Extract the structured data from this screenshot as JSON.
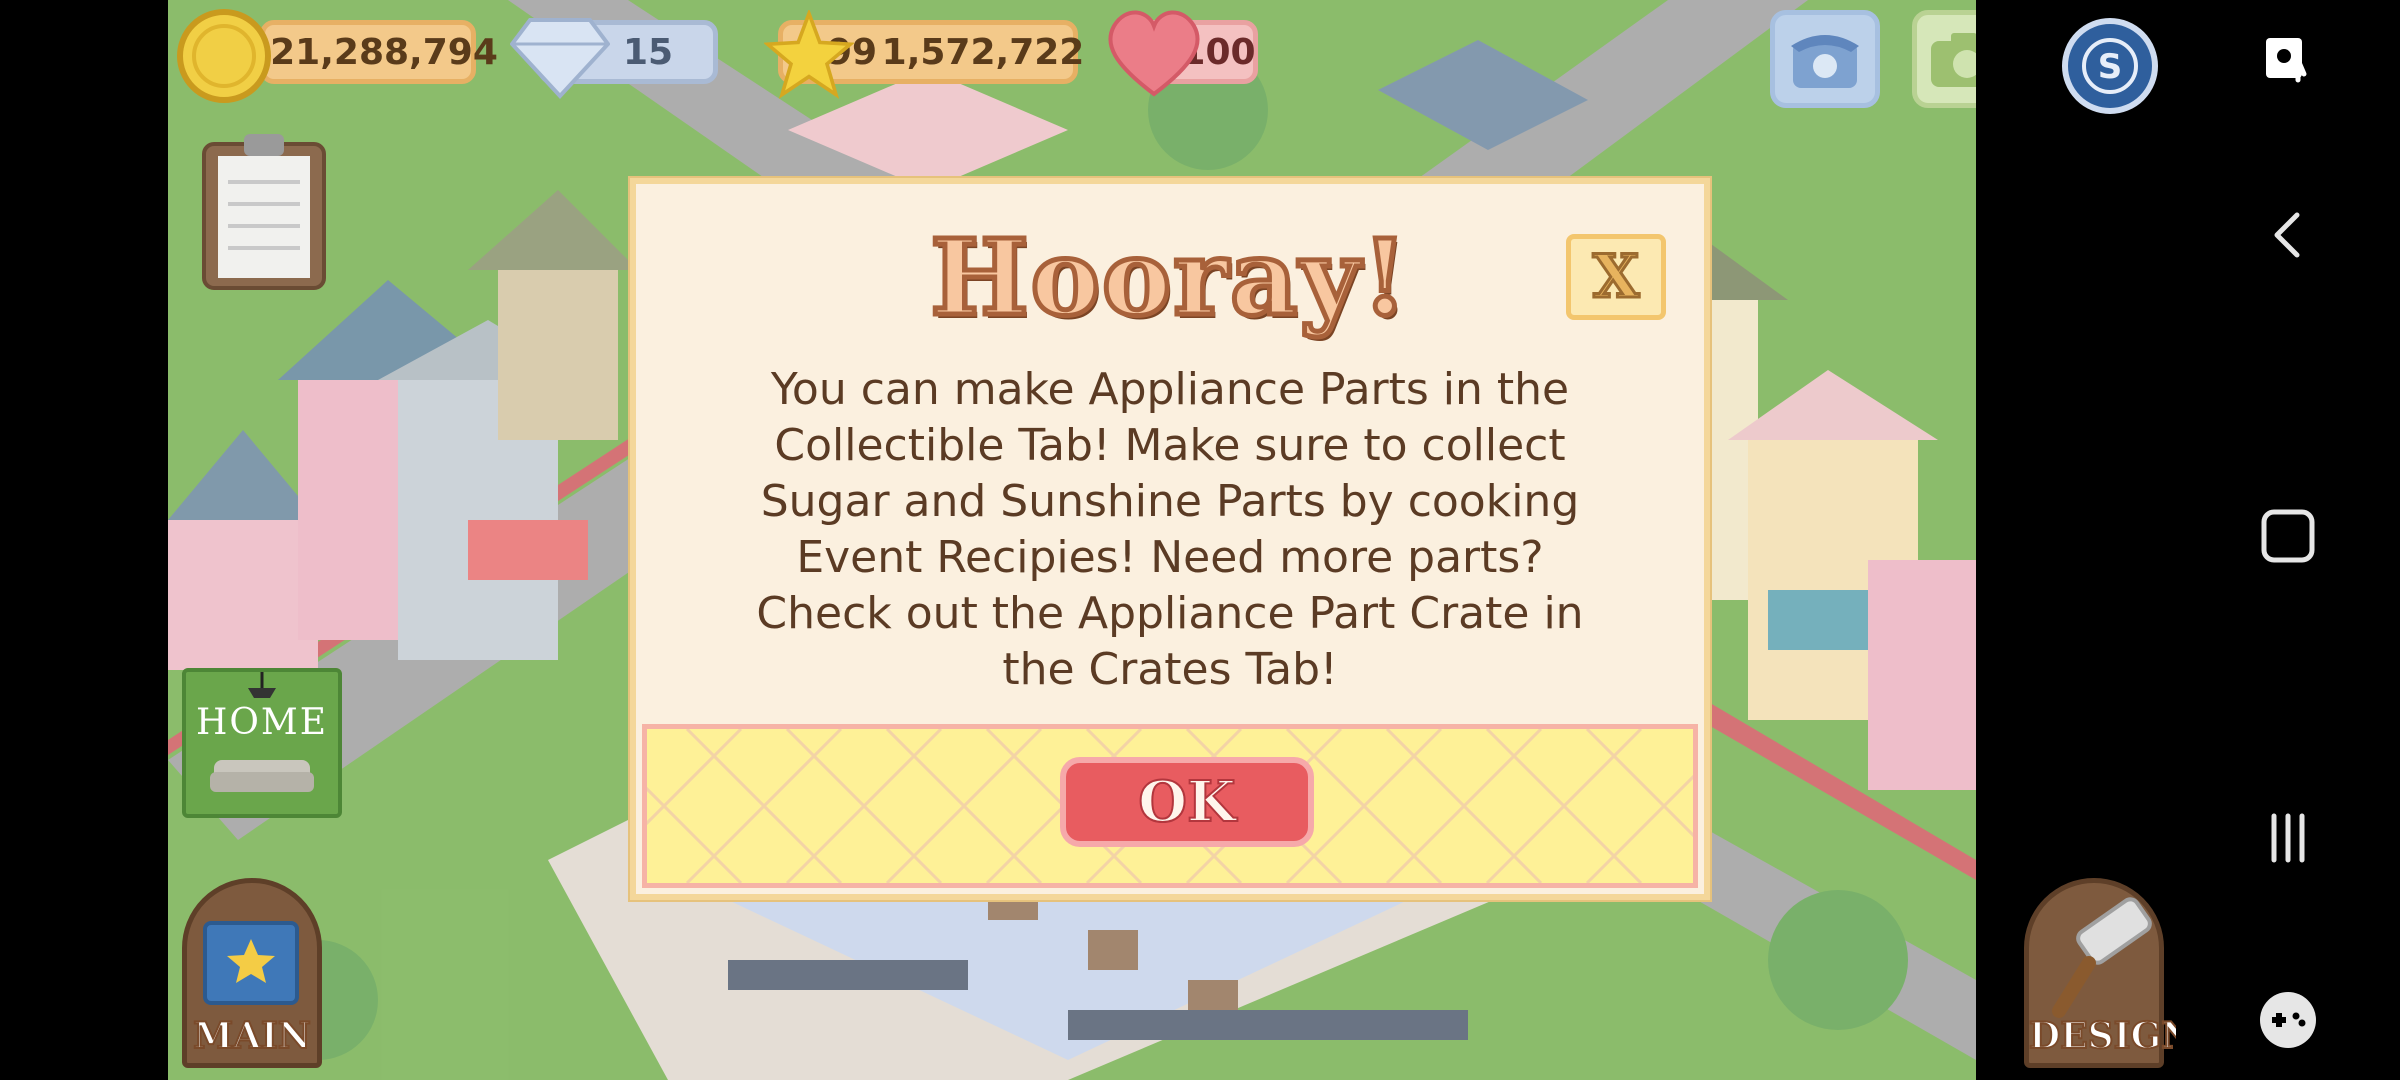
{
  "hud": {
    "coins": "21,288,794",
    "gems": "15",
    "level": "99",
    "xp": "1,572,722",
    "hearts": "100"
  },
  "icons": {
    "coin": "coin-icon",
    "gem": "gem-icon",
    "star": "star-icon",
    "heart": "heart-icon",
    "phone": "phone-icon",
    "camera": "camera-icon",
    "social": "social-icon",
    "clipboard": "clipboard-icon"
  },
  "dialog": {
    "title": "Hooray!",
    "close_label": "X",
    "message": "You can make Appliance Parts in the Collectible Tab! Make sure to collect Sugar and Sunshine Parts by cooking Event Recipies! Need more parts? Check out the Appliance Part Crate in the Crates Tab!",
    "ok_label": "OK"
  },
  "side": {
    "home_label": "HOME",
    "main_label": "MAIN",
    "design_label": "DESIGN"
  },
  "colors": {
    "dialog_bg": "#fbf0df",
    "ok_button": "#e85c60",
    "footer_bg": "#fef197",
    "grass": "#5aa02c"
  }
}
